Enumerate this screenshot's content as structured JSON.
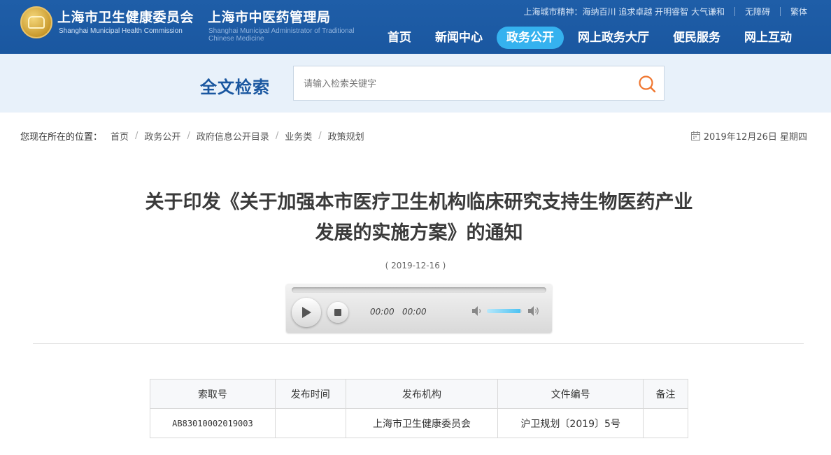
{
  "header": {
    "org1_cn": "上海市卫生健康委员会",
    "org1_en": "Shanghai Municipal Health Commission",
    "org2_cn": "上海市中医药管理局",
    "org2_en": "Shanghai Municipal Administrator of Traditional Chinese Medicine",
    "spirit": "上海城市精神：海纳百川 追求卓越 开明睿智 大气谦和",
    "accessibility": "无障碍",
    "traditional": "繁体",
    "logo_icon": "emblem-logo"
  },
  "nav": {
    "items": [
      {
        "label": "首页",
        "active": false
      },
      {
        "label": "新闻中心",
        "active": false
      },
      {
        "label": "政务公开",
        "active": true
      },
      {
        "label": "网上政务大厅",
        "active": false
      },
      {
        "label": "便民服务",
        "active": false
      },
      {
        "label": "网上互动",
        "active": false
      }
    ],
    "active_color": "#35b2ef"
  },
  "search": {
    "title": "全文检索",
    "placeholder": "请输入检索关键字",
    "icon": "search-icon",
    "icon_color": "#f0762f"
  },
  "breadcrumb": {
    "lead": "您现在所在的位置：",
    "items": [
      "首页",
      "政务公开",
      "政府信息公开目录",
      "业务类",
      "政策规划"
    ],
    "separator": "/"
  },
  "date": "2019年12月26日 星期四",
  "article": {
    "title_line1": "关于印发《关于加强本市医疗卫生机构临床研究支持生物医药产业",
    "title_line2": "发展的实施方案》的通知",
    "pubdate": "( 2019-12-16 )"
  },
  "player": {
    "current_time": "00:00",
    "duration": "00:00",
    "volume_fraction": 0.95
  },
  "meta_table": {
    "headers": [
      "索取号",
      "发布时间",
      "发布机构",
      "文件编号",
      "备注"
    ],
    "row": [
      "AB83010002019003",
      "",
      "上海市卫生健康委员会",
      "沪卫规划〔2019〕5号",
      ""
    ]
  },
  "colors": {
    "header_bg": "#1f5ea8",
    "search_band_bg": "#e8f1fa",
    "search_title": "#1a57a0"
  }
}
